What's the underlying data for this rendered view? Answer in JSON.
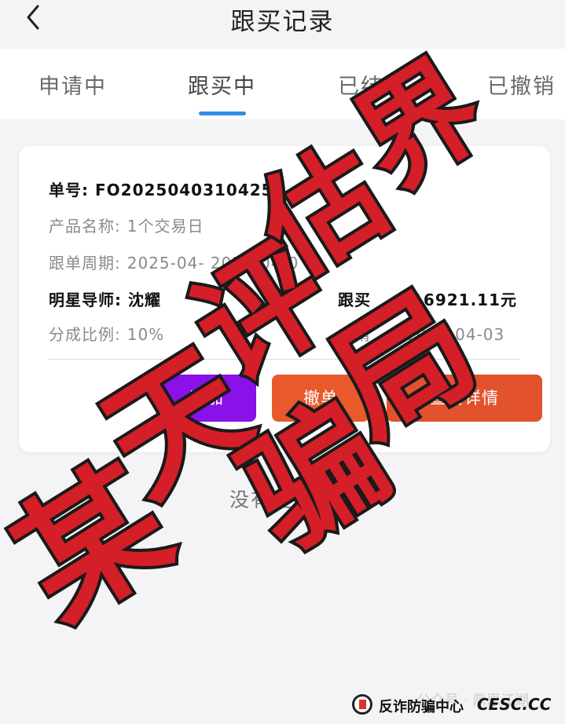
{
  "header": {
    "title": "跟买记录",
    "back_icon": "chevron-left-icon"
  },
  "tabs": [
    "申请中",
    "跟买中",
    "已结",
    "已撤销"
  ],
  "active_tab": 1,
  "order": {
    "order_no_label": "单号:",
    "order_no_value": "FO20250403104254",
    "product_name_label": "产品名称:",
    "product_name_value": "1个交易日",
    "period_label": "跟单周期:",
    "period_value": "2025-04-   2025-04-0",
    "mentor_label": "明星导师:",
    "mentor_value": "沈耀",
    "amount_label": "跟买",
    "amount_value": "16921.11元",
    "ratio_label": "分成比例:",
    "ratio_value": "10%",
    "apply_time_label": "申请",
    "apply_time_value": "2025-04-03"
  },
  "buttons": {
    "btn1_label": "追加",
    "btn2_label": "撤单",
    "btn3_label": "查看详情"
  },
  "no_more": "没有更多了",
  "footer": {
    "faint": "公众号 · 鼎思江湖",
    "label": "反诈防骗中心",
    "brand": "CESC.CC"
  },
  "overlay_text": [
    "某",
    "天",
    "评",
    "估",
    "界",
    "骗",
    "局"
  ],
  "colors": {
    "tab_underline": "#2f8fe6",
    "purple_button": "#8a11e8",
    "orange_button": "#e85a2c",
    "overlay_red": "#d41e28"
  }
}
